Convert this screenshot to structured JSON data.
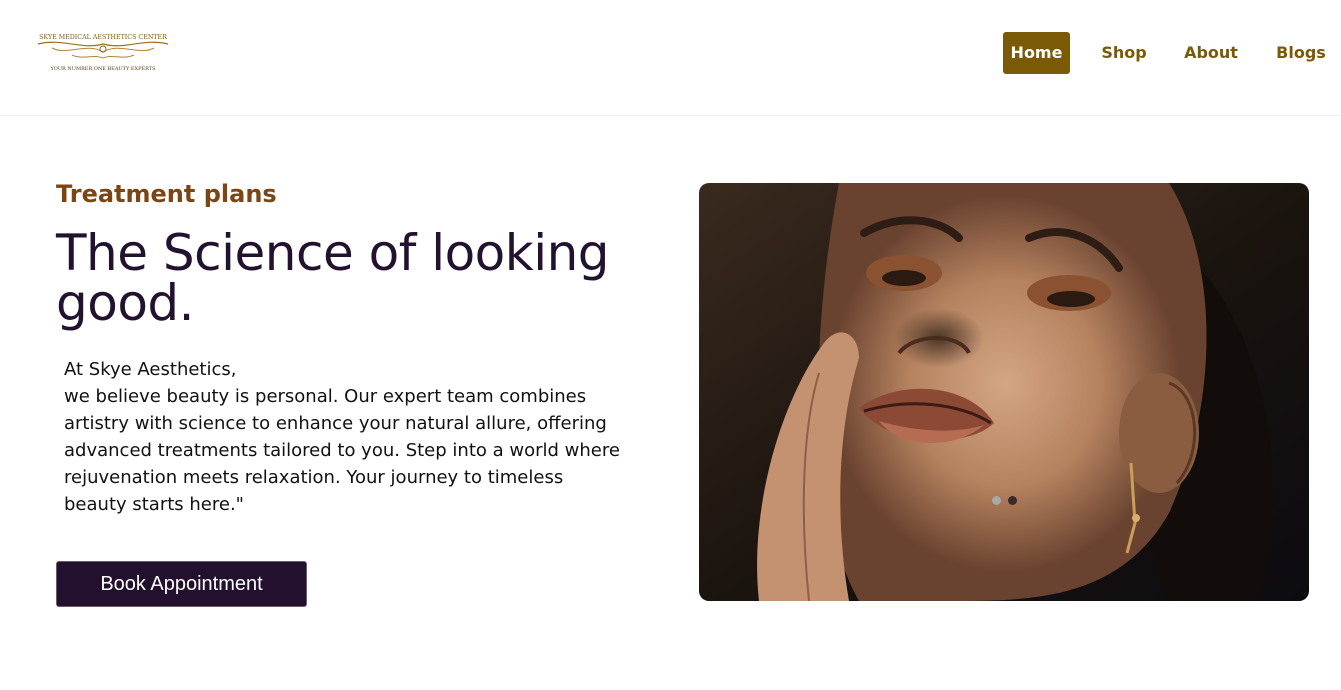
{
  "brand": {
    "name": "SKYE MEDICAL AESTHETICS CENTER",
    "tagline": "YOUR NUMBER ONE BEAUTY EXPERTS"
  },
  "nav": {
    "items": [
      {
        "label": "Home",
        "active": true
      },
      {
        "label": "Shop",
        "active": false
      },
      {
        "label": "About",
        "active": false
      },
      {
        "label": "Blogs",
        "active": false
      }
    ]
  },
  "hero": {
    "eyebrow": "Treatment plans",
    "headline": "The Science of looking good.",
    "intro": "At Skye Aesthetics,",
    "body": "we believe beauty is personal. Our expert team combines artistry with science to enhance your natural allure, offering advanced treatments tailored to you. Step into a world where rejuvenation meets relaxation. Your journey to timeless beauty starts here.\"",
    "cta_label": "Book Appointment",
    "image_alt": "woman with bronze eye makeup",
    "slide_count": 2,
    "active_slide": 1
  },
  "colors": {
    "brand_gold": "#7a5a06",
    "eyebrow_brown": "#7b4613",
    "headline_purple": "#23122f",
    "button_bg": "#23102e"
  }
}
